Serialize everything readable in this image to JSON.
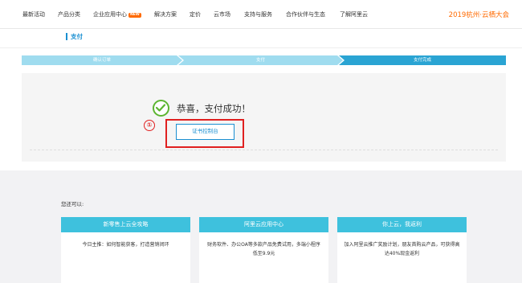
{
  "nav": {
    "items": [
      "最新活动",
      "产品分类",
      "企业应用中心",
      "解决方案",
      "定价",
      "云市场",
      "支持与服务",
      "合作伙伴与生态",
      "了解阿里云"
    ],
    "new_badge": "NEW",
    "brand_event": "2019杭州·云栖大会"
  },
  "page": {
    "title": "支付"
  },
  "steps": [
    "确认订单",
    "支付",
    "支付完成"
  ],
  "success": {
    "message": "恭喜，支付成功！",
    "console_button": "证书控制台",
    "annotation_number": "①"
  },
  "also": {
    "label": "您还可以:",
    "cards": [
      {
        "title": "新零售上云全攻略",
        "body": "今日主推：如何智能获客，打造营销闭环"
      },
      {
        "title": "阿里云应用中心",
        "body": "财务软件、办公OA等多款产品免费试用，多端小程序低至9.9元"
      },
      {
        "title": "你上云，我返利",
        "body": "加入阿里云推广奖励计划，朋友首购云产品，可获得高达40%现金返利"
      }
    ]
  },
  "colors": {
    "accent": "#1a8fd1",
    "brand": "#ff6a00",
    "success": "#5cb531",
    "annotation": "#e02020",
    "step_active": "#2aa4d3",
    "step_inactive": "#9fdcef",
    "card_header": "#3ec1dd"
  },
  "icons": {
    "success": "check-circle-icon"
  }
}
